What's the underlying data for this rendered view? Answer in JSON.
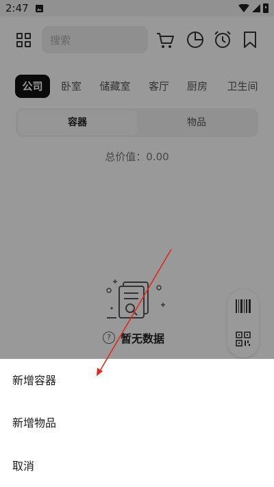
{
  "status_bar": {
    "time": "2:47"
  },
  "search": {
    "placeholder": "搜索"
  },
  "rooms": [
    {
      "label": "公司",
      "active": true
    },
    {
      "label": "卧室",
      "active": false
    },
    {
      "label": "储藏室",
      "active": false
    },
    {
      "label": "客厅",
      "active": false
    },
    {
      "label": "厨房",
      "active": false
    },
    {
      "label": "卫生间",
      "active": false
    }
  ],
  "segment": {
    "containers": "容器",
    "items": "物品",
    "selected": "容器"
  },
  "total_value": "总价值：0.00",
  "empty": {
    "help_glyph": "?",
    "text": "暂无数据"
  },
  "sheet": {
    "add_container": "新增容器",
    "add_item": "新增物品",
    "cancel": "取消"
  },
  "colors": {
    "overlay": "#000000",
    "annotation_arrow": "#e0281b",
    "active_tab": "#111111"
  },
  "icons": [
    "grid-icon",
    "cart-icon",
    "pie-chart-icon",
    "alarm-icon",
    "bookmark-icon",
    "barcode-icon",
    "qr-code-icon",
    "help-icon",
    "empty-document-icon"
  ]
}
